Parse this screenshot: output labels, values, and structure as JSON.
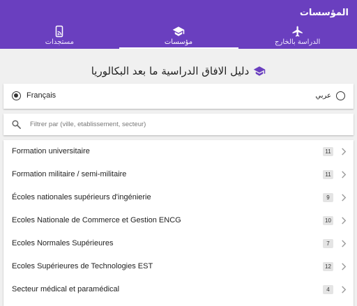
{
  "app": {
    "title": "المؤسسات"
  },
  "tabs": [
    {
      "label": "مستجدات",
      "icon": "phone-cast-icon",
      "active": false
    },
    {
      "label": "مؤسسات",
      "icon": "graduation-cap-icon",
      "active": true
    },
    {
      "label": "الدراسة بالخارج",
      "icon": "airplane-icon",
      "active": false
    }
  ],
  "heading": {
    "text": "دليل الافاق الدراسية ما بعد البكالوريا",
    "icon": "graduation-cap-icon"
  },
  "language": {
    "french_label": "Français",
    "arabic_label": "عربي",
    "selected": "french"
  },
  "search": {
    "value": "",
    "placeholder": "Filtrer par (ville, etablissement, secteur)"
  },
  "categories": [
    {
      "label": "Formation universitaire",
      "count": "11"
    },
    {
      "label": "Formation militaire / semi-militaire",
      "count": "11"
    },
    {
      "label": "Écoles nationales supérieurs d'ingénierie",
      "count": "9"
    },
    {
      "label": "Ecoles Nationale de Commerce et Gestion ENCG",
      "count": "10"
    },
    {
      "label": "Ecoles Normales Supérieures",
      "count": "7"
    },
    {
      "label": "Ecoles Supérieures de Technologies EST",
      "count": "12"
    },
    {
      "label": "Secteur médical et paramédical",
      "count": "4"
    }
  ],
  "colors": {
    "primary": "#6a3fbf",
    "background": "#f0f0f0"
  }
}
